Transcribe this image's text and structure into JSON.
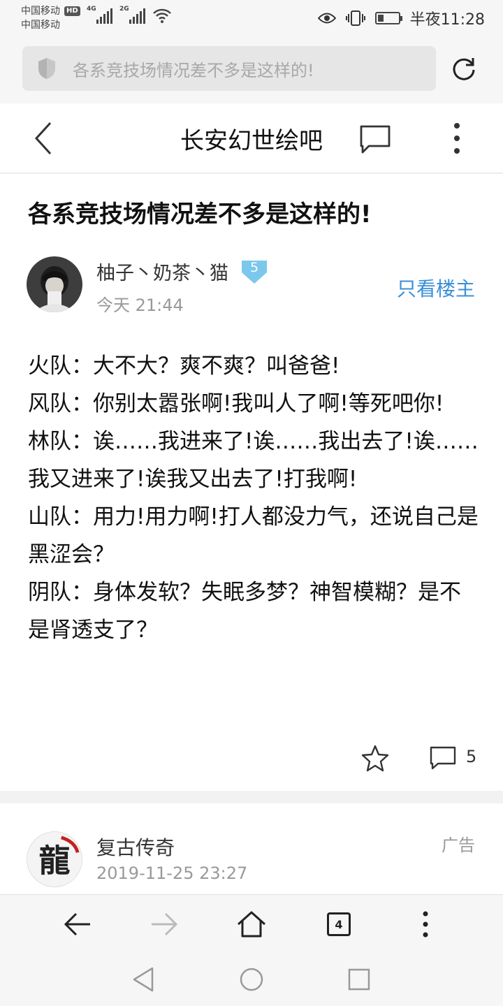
{
  "status_bar": {
    "carrier_1": "中国移动",
    "carrier_1_badge": "HD",
    "carrier_2": "中国移动",
    "net_1": "4G",
    "net_2": "2G",
    "time": "半夜11:28",
    "battery_level": 0.3
  },
  "address_bar": {
    "url_text": "各系竞技场情况差不多是这样的!"
  },
  "header": {
    "title": "长安幻世绘吧"
  },
  "post": {
    "title": "各系竞技场情况差不多是这样的!",
    "author": "柚子丶奶茶丶猫",
    "level": "5",
    "time": "今天 21:44",
    "only_op_label": "只看楼主",
    "body_lines": [
      "火队：大不大？爽不爽？叫爸爸!",
      "风队：你别太嚣张啊!我叫人了啊!等死吧你!",
      "林队：诶……我进来了!诶……我出去了!诶……我又进来了!诶我又出去了!打我啊!",
      "山队：用力!用力啊!打人都没力气，还说自己是黑涩会？",
      "阴队：身体发软？失眠多梦？神智模糊？是不是肾透支了？"
    ],
    "comment_count": "5"
  },
  "ad": {
    "name": "复古传奇",
    "tag": "广告",
    "time": "2019-11-25 23:27",
    "logo_char": "龍"
  },
  "browser_bar": {
    "tab_count": "4"
  },
  "colors": {
    "link_blue": "#3b8fd8",
    "badge_blue": "#7cc8ec",
    "text_dark": "#111111",
    "text_gray": "#999999"
  }
}
